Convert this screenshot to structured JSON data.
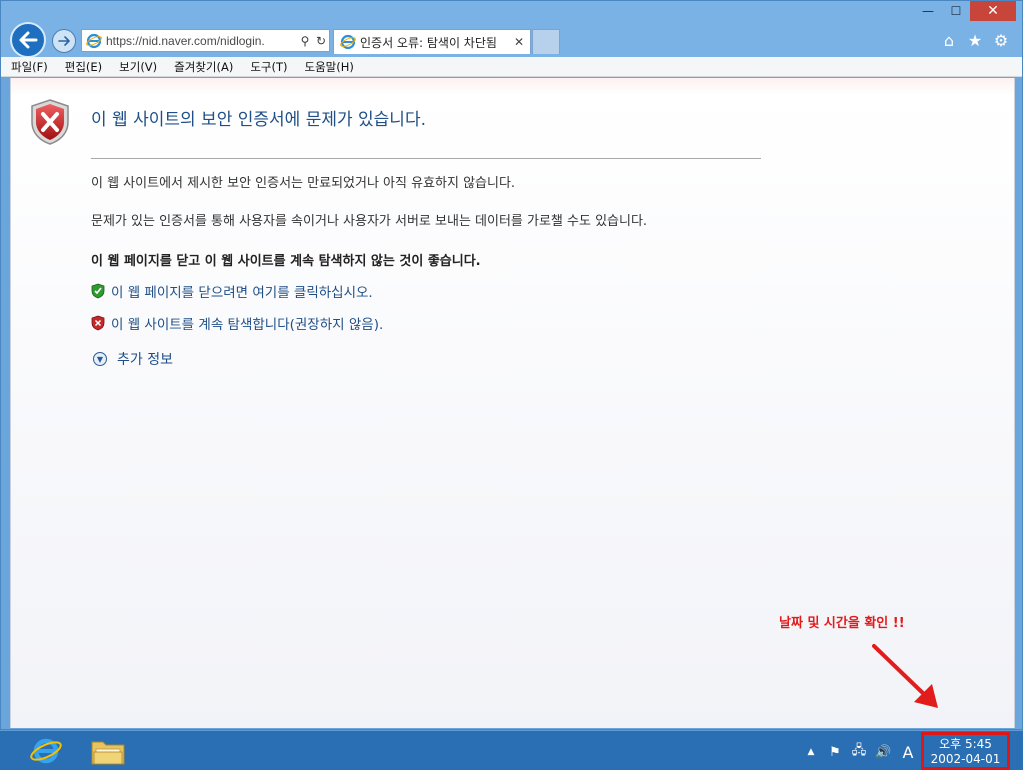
{
  "window": {
    "controls": {
      "minimize": "—",
      "maximize": "☐",
      "close": "✕"
    }
  },
  "nav": {
    "back_icon": "back-arrow-icon",
    "forward_icon": "forward-arrow-icon"
  },
  "address": {
    "url": "https://nid.naver.com/nidlogin.",
    "search_glyph": "⚲",
    "refresh_glyph": "↻"
  },
  "tab": {
    "title": "인증서 오류: 탐색이 차단됨",
    "close": "✕"
  },
  "toolbar_icons": {
    "home": "⌂",
    "favorites": "★",
    "tools": "⚙"
  },
  "menubar": [
    "파일(F)",
    "편집(E)",
    "보기(V)",
    "즐겨찾기(A)",
    "도구(T)",
    "도움말(H)"
  ],
  "page": {
    "title": "이 웹 사이트의 보안 인증서에 문제가 있습니다.",
    "para1": "이 웹 사이트에서 제시한 보안 인증서는 만료되었거나 아직 유효하지 않습니다.",
    "para2": "문제가 있는 인증서를 통해 사용자를 속이거나 사용자가 서버로 보내는 데이터를 가로챌 수도 있습니다.",
    "recommend": "이 웹 페이지를 닫고 이 웹 사이트를 계속 탐색하지 않는 것이 좋습니다.",
    "link_close": "이 웹 페이지를 닫으려면 여기를 클릭하십시오.",
    "link_continue": "이 웹 사이트를 계속 탐색합니다(권장하지 않음).",
    "more_info": "추가 정보"
  },
  "annotation": {
    "text": "날짜 및 시간을 확인 !!",
    "color": "#e21b1b"
  },
  "taskbar": {
    "tray": {
      "up": "▲",
      "flag": "⚑",
      "network": "🖧",
      "volume": "🔊",
      "ime": "A"
    },
    "clock_time": "오후 5:45",
    "clock_date": "2002-04-01"
  },
  "colors": {
    "accent": "#1f4f87",
    "taskbar": "#2a6fb3",
    "highlight": "#e01515"
  }
}
